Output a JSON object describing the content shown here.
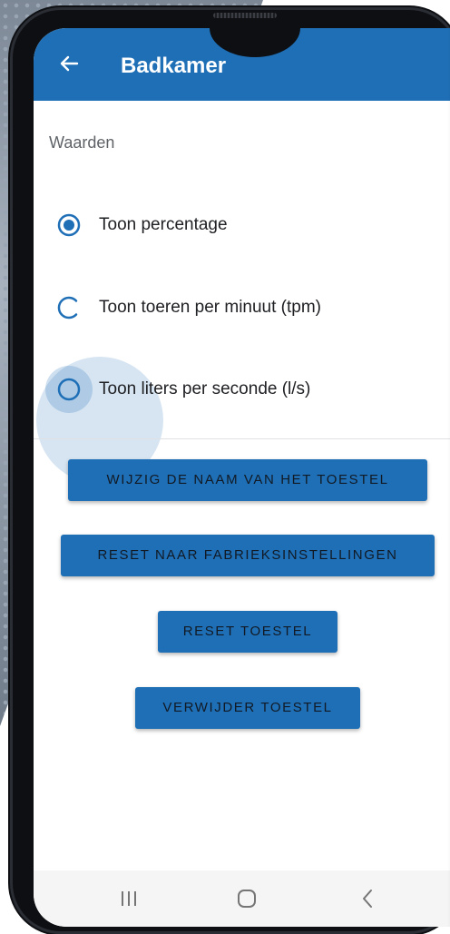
{
  "app": {
    "title": "Badkamer"
  },
  "settings": {
    "section_label": "Waarden",
    "options": [
      {
        "label": "Toon percentage",
        "state": "selected"
      },
      {
        "label": "Toon toeren per minuut (tpm)",
        "state": "loading"
      },
      {
        "label": "Toon liters per seconde (l/s)",
        "state": "pressed"
      }
    ]
  },
  "actions": {
    "rename": "WIJZIG DE NAAM VAN HET TOESTEL",
    "factory_reset": "RESET NAAR FABRIEKSINSTELLINGEN",
    "reset": "RESET TOESTEL",
    "delete": "VERWIJDER TOESTEL"
  },
  "navigation": {
    "recents_icon": "recents-icon",
    "home_icon": "home-icon",
    "back_icon": "back-icon"
  },
  "colors": {
    "primary": "#1f6fb7",
    "button_text": "#111a24",
    "navbar": "#f5f5f6"
  }
}
